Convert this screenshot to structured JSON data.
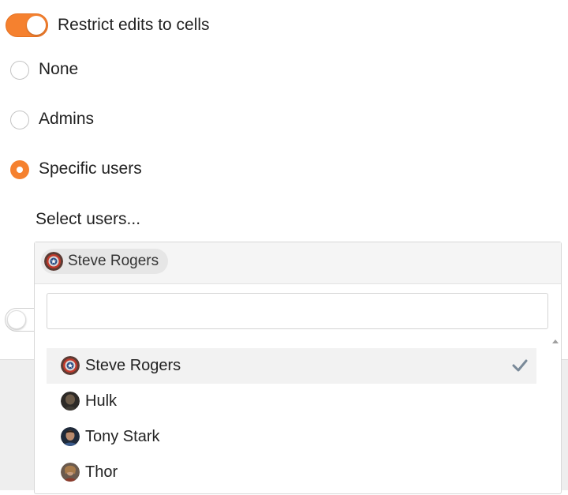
{
  "restrict_toggle": {
    "label": "Restrict edits to cells",
    "on": true
  },
  "radio_options": [
    {
      "label": "None",
      "checked": false
    },
    {
      "label": "Admins",
      "checked": false
    },
    {
      "label": "Specific users",
      "checked": true
    }
  ],
  "select_users": {
    "label": "Select users...",
    "selected_chips": [
      {
        "name": "Steve Rogers",
        "icon": "captain-america-shield-avatar"
      }
    ],
    "search": {
      "value": "",
      "placeholder": ""
    },
    "options": [
      {
        "name": "Steve Rogers",
        "selected": true,
        "icon": "captain-america-shield-avatar"
      },
      {
        "name": "Hulk",
        "selected": false,
        "icon": "hulk-avatar"
      },
      {
        "name": "Tony Stark",
        "selected": false,
        "icon": "tony-stark-avatar"
      },
      {
        "name": "Thor",
        "selected": false,
        "icon": "thor-avatar"
      }
    ]
  },
  "second_toggle": {
    "on": false
  },
  "colors": {
    "accent": "#f5812f",
    "check": "#7a8a99"
  }
}
